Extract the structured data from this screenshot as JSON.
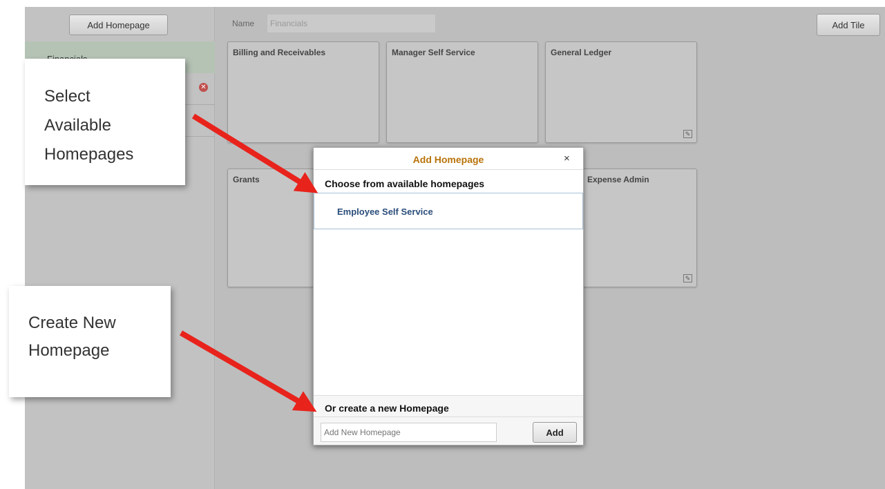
{
  "sidebar": {
    "add_homepage_label": "Add Homepage",
    "items": [
      {
        "label": "Financials"
      }
    ]
  },
  "header": {
    "name_label": "Name",
    "name_value": "Financials",
    "add_tile_label": "Add Tile"
  },
  "tiles": [
    {
      "title": "Billing and Receivables"
    },
    {
      "title": "Manager Self Service"
    },
    {
      "title": "General Ledger"
    },
    {
      "title": "Grants"
    },
    {
      "title": "Expense Admin"
    }
  ],
  "callouts": {
    "select_text": "Select Available Homepages",
    "select_lines": [
      "Select",
      "Available",
      "Homepages"
    ],
    "create_lines": [
      "Create New",
      "Homepage"
    ]
  },
  "dialog": {
    "title": "Add Homepage",
    "close_symbol": "×",
    "choose_label": "Choose from available homepages",
    "available": [
      "Employee Self Service"
    ],
    "create_label": "Or create a new Homepage",
    "input_placeholder": "Add New Homepage",
    "add_label": "Add"
  },
  "colors": {
    "dialog_title": "#b8730a",
    "list_item": "#2a4d7a",
    "arrow": "#e8231c",
    "remove_icon": "#c0504d"
  },
  "icons": {
    "remove": "remove-circle-icon",
    "edit": "edit-tile-icon",
    "close": "close-icon"
  }
}
